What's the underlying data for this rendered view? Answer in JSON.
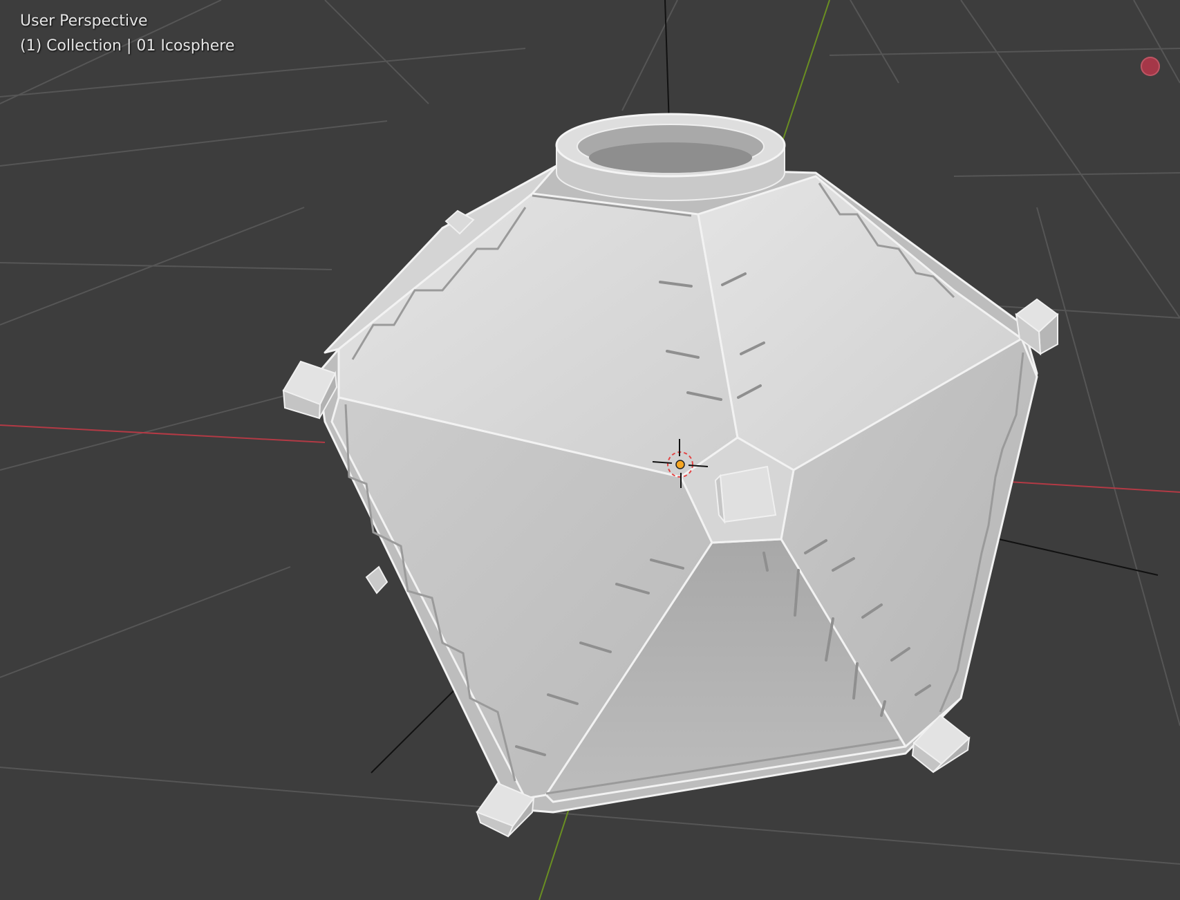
{
  "viewport": {
    "view_name": "User Perspective",
    "object_info": "(1) Collection | 01 Icosphere"
  },
  "scene": {
    "object_name": "01 Icosphere",
    "axes": {
      "x_color": "#b33a45",
      "y_color": "#6a8f22",
      "z_color": "#1a1a1a"
    },
    "background_color": "#3d3d3d",
    "grid_color": "#5a5a5a",
    "mesh_color": "#cfcfcf"
  },
  "overlay": {
    "record_icon": "record-icon",
    "cursor_icon": "3d-cursor-icon",
    "origin_icon": "object-origin-icon"
  }
}
